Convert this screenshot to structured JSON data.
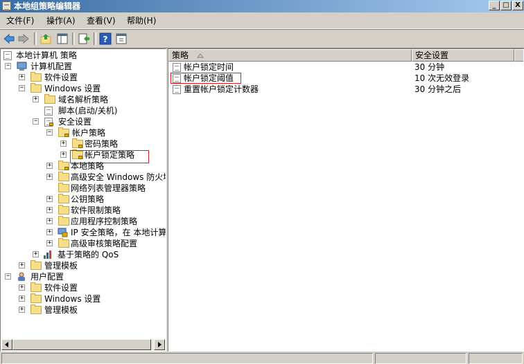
{
  "window": {
    "title": "本地组策略编辑器",
    "buttons": {
      "minimize": "_",
      "maximize": "□",
      "close": "X"
    }
  },
  "menu": [
    {
      "label": "文件(F)"
    },
    {
      "label": "操作(A)"
    },
    {
      "label": "查看(V)"
    },
    {
      "label": "帮助(H)"
    }
  ],
  "toolbar": {
    "icons": [
      "back-arrow-icon",
      "forward-arrow-icon",
      "up-folder-icon",
      "show-hide-tree-icon",
      "export-list-icon",
      "help-icon",
      "properties-icon"
    ]
  },
  "tree": {
    "root": "本地计算机 策略",
    "computer_config": "计算机配置",
    "software_settings": "软件设置",
    "windows_settings": "Windows 设置",
    "dns_policy": "域名解析策略",
    "scripts": "脚本(启动/关机)",
    "security_settings": "安全设置",
    "account_policies": "帐户策略",
    "password_policy": "密码策略",
    "lockout_policy": "帐户锁定策略",
    "local_policies": "本地策略",
    "firewall": "高级安全 Windows 防火墙",
    "network_list": "网络列表管理器策略",
    "public_key": "公钥策略",
    "software_restriction": "软件限制策略",
    "app_control": "应用程序控制策略",
    "ip_security": "IP 安全策略，在 本地计算机",
    "audit": "高级审核策略配置",
    "qos": "基于策略的 QoS",
    "admin_templates": "管理模板",
    "user_config": "用户配置",
    "user_software_settings": "软件设置",
    "user_windows_settings": "Windows 设置",
    "user_admin_templates": "管理模板"
  },
  "list": {
    "columns": {
      "policy": "策略",
      "setting": "安全设置"
    },
    "rows": [
      {
        "policy": "帐户锁定时间",
        "setting": "30 分钟"
      },
      {
        "policy": "帐户锁定阈值",
        "setting": "10 次无效登录"
      },
      {
        "policy": "重置帐户锁定计数器",
        "setting": "30 分钟之后"
      }
    ]
  },
  "colors": {
    "titlebar_start": "#3a6ea5",
    "titlebar_end": "#a6caf0",
    "highlight_box": "#e02020",
    "folder": "#f6de8c"
  }
}
